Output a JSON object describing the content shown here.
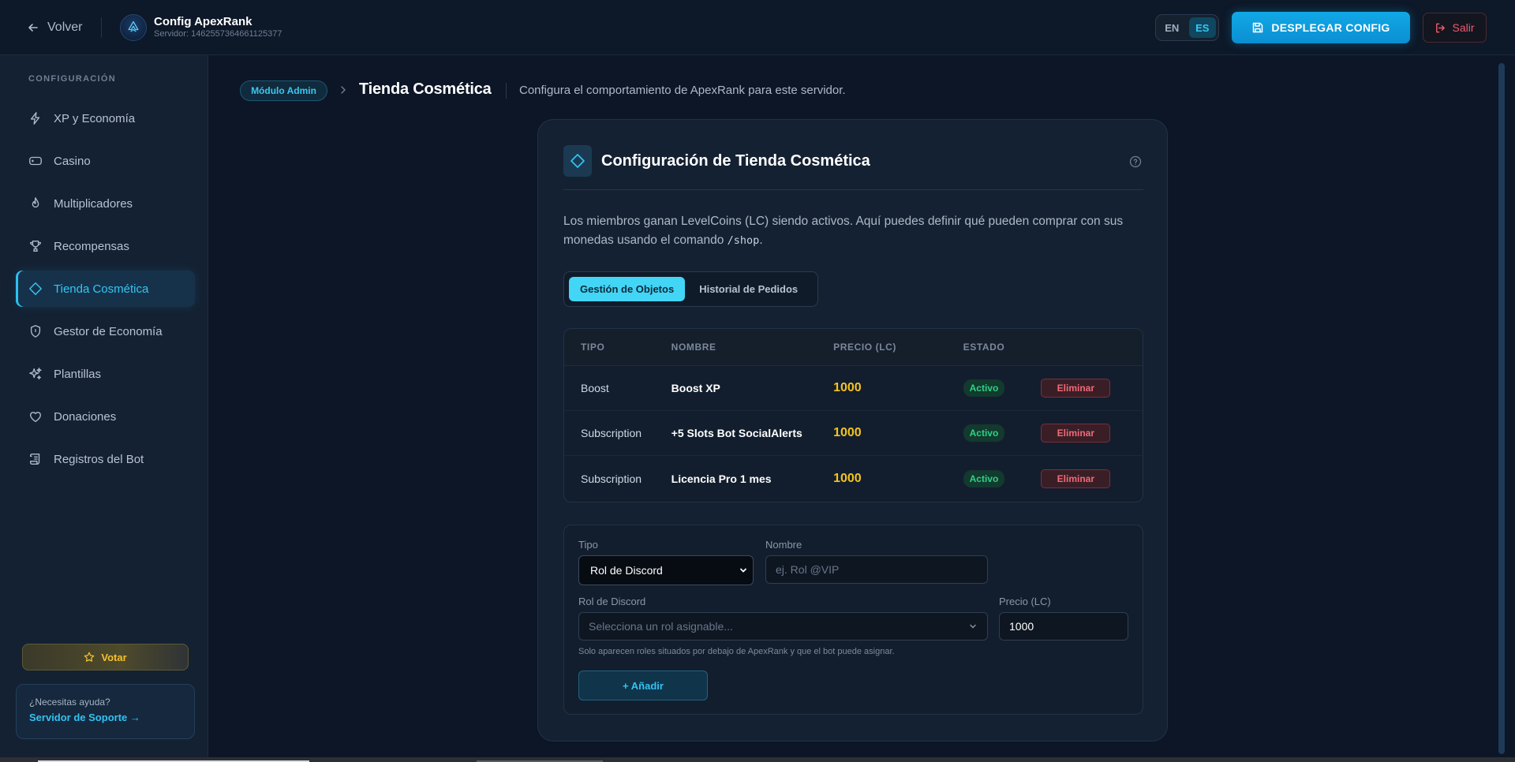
{
  "topbar": {
    "back_label": "Volver",
    "brand_title": "Config ApexRank",
    "brand_server": "Servidor: 1462557364661125377",
    "lang_en": "EN",
    "lang_es": "ES",
    "deploy_label": "DESPLEGAR CONFIG",
    "exit_label": "Salir"
  },
  "sidebar": {
    "heading": "CONFIGURACIÓN",
    "items": [
      {
        "label": "XP y Economía",
        "icon": "bolt-icon"
      },
      {
        "label": "Casino",
        "icon": "gamepad-icon"
      },
      {
        "label": "Multiplicadores",
        "icon": "flame-icon"
      },
      {
        "label": "Recompensas",
        "icon": "trophy-icon"
      },
      {
        "label": "Tienda Cosmética",
        "icon": "diamond-icon",
        "active": true
      },
      {
        "label": "Gestor de Economía",
        "icon": "shield-icon"
      },
      {
        "label": "Plantillas",
        "icon": "sparkles-icon"
      },
      {
        "label": "Donaciones",
        "icon": "heart-icon"
      },
      {
        "label": "Registros del Bot",
        "icon": "scroll-icon"
      }
    ],
    "vote_label": "Votar",
    "help_question": "¿Necesitas ayuda?",
    "help_link": "Servidor de Soporte →"
  },
  "header": {
    "badge": "Módulo Admin",
    "title": "Tienda Cosmética",
    "description": "Configura el comportamiento de ApexRank para este servidor."
  },
  "card": {
    "title": "Configuración de Tienda Cosmética",
    "intro_text": "Los miembros ganan LevelCoins (LC) siendo activos. Aquí puedes definir qué pueden comprar con sus monedas usando el comando ",
    "intro_command": "/shop",
    "intro_end": ".",
    "tabs": [
      {
        "label": "Gestión de Objetos",
        "active": true
      },
      {
        "label": "Historial de Pedidos",
        "active": false
      }
    ],
    "table": {
      "headers": [
        "TIPO",
        "NOMBRE",
        "PRECIO (LC)",
        "ESTADO"
      ],
      "rows": [
        {
          "type": "Boost",
          "name": "Boost XP",
          "price": "1000",
          "status": "Activo",
          "action": "Eliminar"
        },
        {
          "type": "Subscription",
          "name": "+5 Slots Bot SocialAlerts",
          "price": "1000",
          "status": "Activo",
          "action": "Eliminar"
        },
        {
          "type": "Subscription",
          "name": "Licencia Pro 1 mes",
          "price": "1000",
          "status": "Activo",
          "action": "Eliminar"
        }
      ]
    },
    "form": {
      "type_label": "Tipo",
      "type_value": "Rol de Discord",
      "name_label": "Nombre",
      "name_placeholder": "ej. Rol @VIP",
      "role_label": "Rol de Discord",
      "role_placeholder": "Selecciona un rol asignable...",
      "price_label": "Precio (LC)",
      "price_value": "1000",
      "hint": "Solo aparecen roles situados por debajo de ApexRank y que el bot puede asignar.",
      "add_label": "+ Añadir"
    }
  },
  "colors": {
    "accent": "#2bc1f0",
    "price": "#f6c31f",
    "active_status": "#2fd186",
    "danger": "#f06a78"
  }
}
